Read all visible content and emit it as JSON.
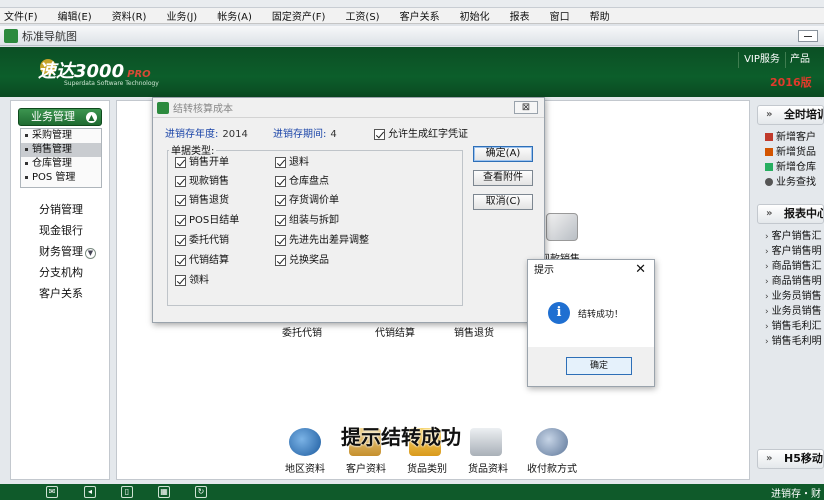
{
  "menubar": {
    "items": [
      "文件(F)",
      "编辑(E)",
      "资料(R)",
      "业务(J)",
      "帐务(A)",
      "固定资产(F)",
      "工资(S)",
      "客户关系",
      "初始化",
      "报表",
      "窗口",
      "帮助"
    ]
  },
  "nav_header": {
    "title": "标准导航图"
  },
  "banner": {
    "logo_text": "速达3000",
    "logo_suffix": "PRO",
    "logo_sub": "Superdata Software Technology",
    "vip_label": "VIP服务",
    "product_label": "产品",
    "edition": "2016版"
  },
  "left_nav": {
    "header": "业务管理",
    "sub_items": [
      "采购管理",
      "销售管理",
      "仓库管理",
      "POS 管理"
    ],
    "items": [
      "分销管理",
      "现金银行",
      "财务管理",
      "分支机构",
      "客户关系"
    ]
  },
  "center": {
    "labels_mid": [
      "委托代销",
      "代销结算",
      "销售退货"
    ],
    "bg_label": "现款销售",
    "bottom_icons": [
      "地区资料",
      "客户资料",
      "货品类别",
      "货品资料",
      "收付款方式"
    ]
  },
  "right_panel": {
    "training_title": "全时培训",
    "training_items": [
      "新增客户",
      "新增货品",
      "新增仓库",
      "业务查找"
    ],
    "report_title": "报表中心",
    "report_items": [
      "客户销售汇",
      "客户销售明",
      "商品销售汇",
      "商品销售明",
      "业务员销售",
      "业务员销售",
      "销售毛利汇",
      "销售毛利明"
    ],
    "mobile_title": "H5移动"
  },
  "dialog": {
    "title": "结转核算成本",
    "year_label": "进销存年度:",
    "year_value": "2014",
    "period_label": "进销存期间:",
    "period_value": "4",
    "allow_red": "允许生成红字凭证",
    "group_label": "单据类型:",
    "col1": [
      "销售开单",
      "现款销售",
      "销售退货",
      "POS日结单",
      "委托代销",
      "代销结算",
      "领料"
    ],
    "col2": [
      "退料",
      "仓库盘点",
      "存货调价单",
      "组装与拆卸",
      "先进先出差异调整",
      "兑换奖品"
    ],
    "ok": "确定(A)",
    "attach": "查看附件",
    "cancel": "取消(C)",
    "close": "⊠"
  },
  "message": {
    "title": "提示",
    "text": "结转成功！",
    "ok": "确定",
    "icon_glyph": "i",
    "close_glyph": "✕"
  },
  "caption": "提示结转成功",
  "statusbar": {
    "text": "进销存・财"
  },
  "colors": {
    "brand_green": "#0c5e2b",
    "accent_red": "#e03a2b",
    "link_blue": "#1a44a8"
  }
}
